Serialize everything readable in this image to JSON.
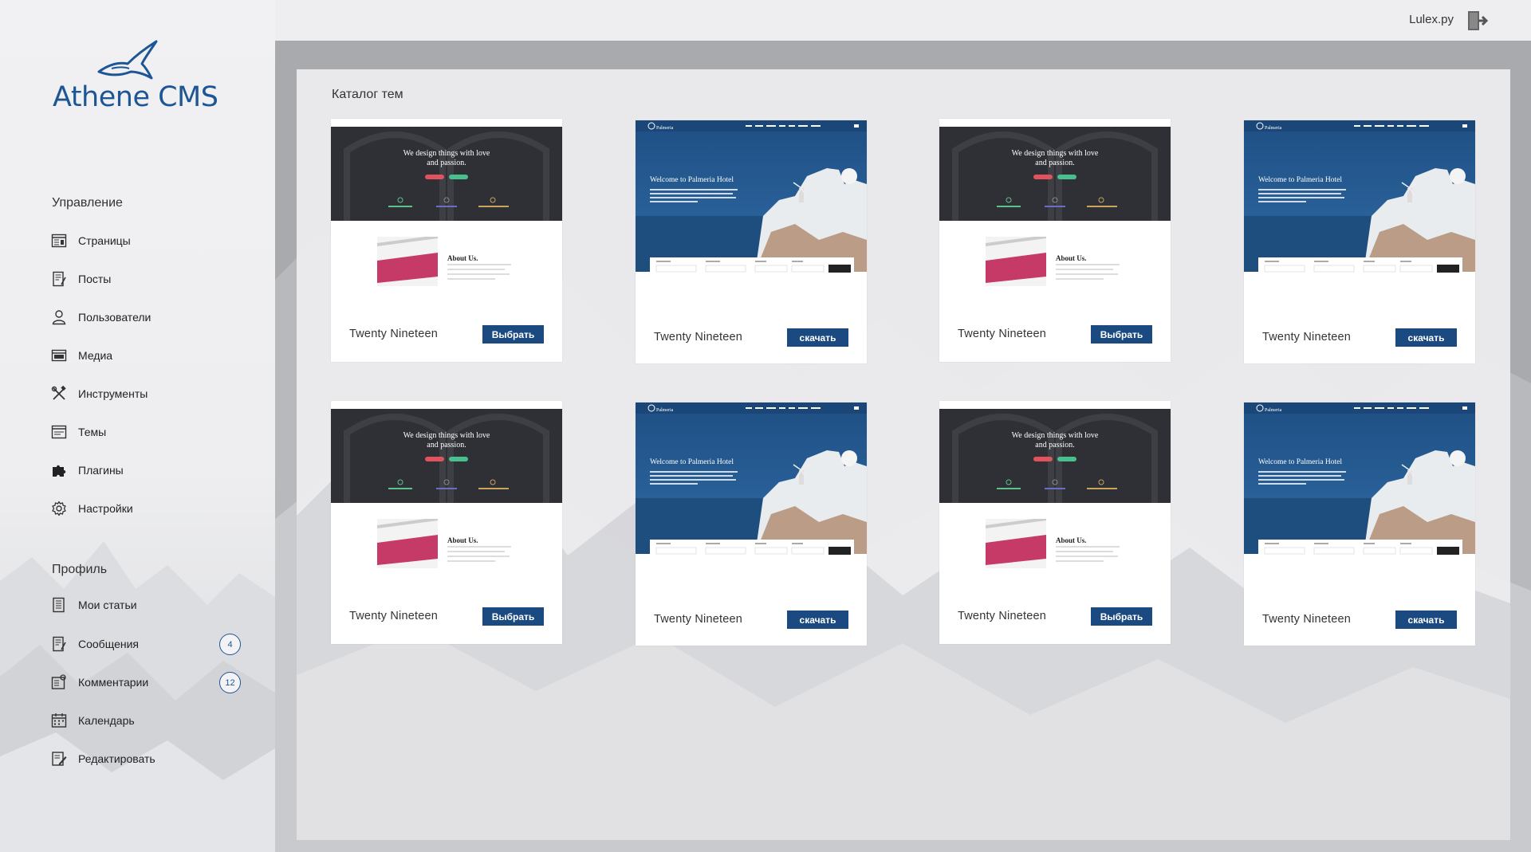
{
  "header": {
    "user_name": "Lulex.py",
    "logout_icon": "logout-icon"
  },
  "brand": {
    "name": "Athene CMS",
    "color": "#1d5695",
    "accent": "#1b4a80"
  },
  "sidebar": {
    "management_title": "Управление",
    "management_items": [
      {
        "label": "Страницы",
        "icon": "pages-icon"
      },
      {
        "label": "Посты",
        "icon": "posts-icon"
      },
      {
        "label": "Пользователи",
        "icon": "user-icon"
      },
      {
        "label": "Медиа",
        "icon": "media-icon"
      },
      {
        "label": "Инструменты",
        "icon": "tools-icon"
      },
      {
        "label": "Темы",
        "icon": "themes-icon"
      },
      {
        "label": "Плагины",
        "icon": "puzzle-icon"
      },
      {
        "label": "Настройки",
        "icon": "gear-icon"
      }
    ],
    "profile_title": "Профиль",
    "profile_items": [
      {
        "label": "Мои статьи",
        "icon": "articles-icon",
        "badge": null
      },
      {
        "label": "Сообщения",
        "icon": "messages-icon",
        "badge": "4"
      },
      {
        "label": "Комментарии",
        "icon": "comments-icon",
        "badge": "12"
      },
      {
        "label": "Календарь",
        "icon": "calendar-icon",
        "badge": null
      },
      {
        "label": "Редактировать",
        "icon": "edit-icon",
        "badge": null
      }
    ]
  },
  "main": {
    "catalog_title": "Каталог тем",
    "themes": [
      {
        "name": "Twenty Nineteen",
        "button": "Выбрать",
        "preview": "twenty-nineteen",
        "thumb_heading_1": "We design things with love",
        "thumb_heading_2": "and passion.",
        "thumb_about": "About Us."
      },
      {
        "name": "Twenty Nineteen",
        "button": "скачать",
        "preview": "palmeria",
        "thumb_brand": "Palmeria",
        "thumb_title": "Welcome to Palmeria Hotel"
      },
      {
        "name": "Twenty Nineteen",
        "button": "Выбрать",
        "preview": "twenty-nineteen",
        "thumb_heading_1": "We design things with love",
        "thumb_heading_2": "and passion.",
        "thumb_about": "About Us."
      },
      {
        "name": "Twenty Nineteen",
        "button": "скачать",
        "preview": "palmeria",
        "thumb_brand": "Palmeria",
        "thumb_title": "Welcome to Palmeria Hotel"
      },
      {
        "name": "Twenty Nineteen",
        "button": "Выбрать",
        "preview": "twenty-nineteen",
        "thumb_heading_1": "We design things with love",
        "thumb_heading_2": "and passion.",
        "thumb_about": "About Us."
      },
      {
        "name": "Twenty Nineteen",
        "button": "скачать",
        "preview": "palmeria",
        "thumb_brand": "Palmeria",
        "thumb_title": "Welcome to Palmeria Hotel"
      },
      {
        "name": "Twenty Nineteen",
        "button": "Выбрать",
        "preview": "twenty-nineteen",
        "thumb_heading_1": "We design things with love",
        "thumb_heading_2": "and passion.",
        "thumb_about": "About Us."
      },
      {
        "name": "Twenty Nineteen",
        "button": "скачать",
        "preview": "palmeria",
        "thumb_brand": "Palmeria",
        "thumb_title": "Welcome to Palmeria Hotel"
      }
    ]
  }
}
